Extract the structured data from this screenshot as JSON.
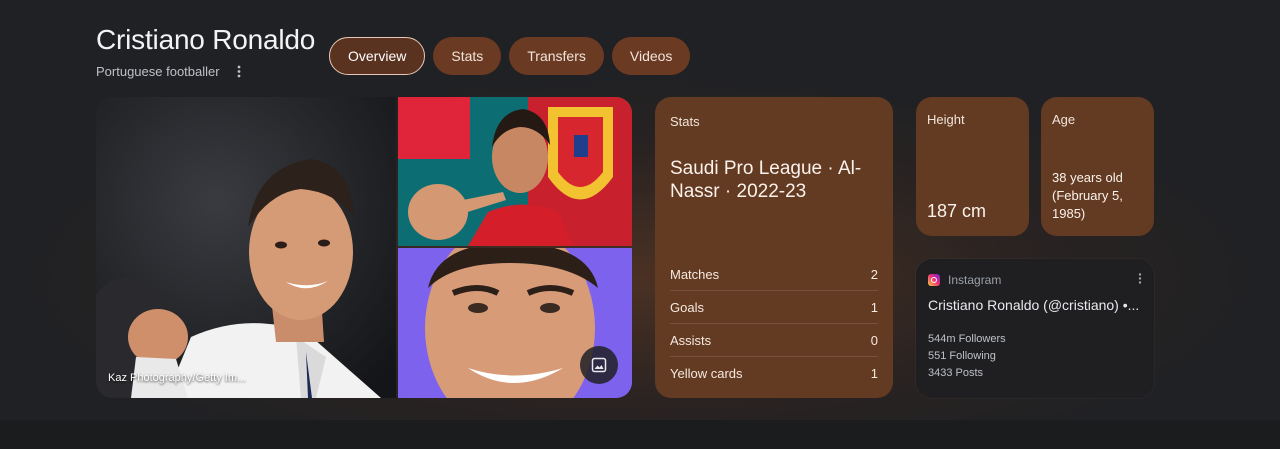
{
  "header": {
    "title": "Cristiano Ronaldo",
    "subtitle": "Portuguese footballer"
  },
  "tabs": [
    {
      "label": "Overview",
      "active": true
    },
    {
      "label": "Stats",
      "active": false
    },
    {
      "label": "Transfers",
      "active": false
    },
    {
      "label": "Videos",
      "active": false
    }
  ],
  "gallery": {
    "credit": "Kaz Photography/Getty Im..."
  },
  "stats_card": {
    "label": "Stats",
    "league": "Saudi Pro League · Al-Nassr · 2022-23",
    "rows": [
      {
        "label": "Matches",
        "value": "2"
      },
      {
        "label": "Goals",
        "value": "1"
      },
      {
        "label": "Assists",
        "value": "0"
      },
      {
        "label": "Yellow cards",
        "value": "1"
      }
    ]
  },
  "height_card": {
    "label": "Height",
    "value": "187 cm"
  },
  "age_card": {
    "label": "Age",
    "value": "38 years old (February 5, 1985)"
  },
  "instagram_card": {
    "source": "Instagram",
    "name": "Cristiano Ronaldo (@cristiano) •...",
    "followers": "544m Followers",
    "following": "551 Following",
    "posts": "3433 Posts"
  },
  "colors": {
    "page_background": "#202124",
    "card_brown": "#633a22",
    "tab_brown": "#6b3a22"
  }
}
